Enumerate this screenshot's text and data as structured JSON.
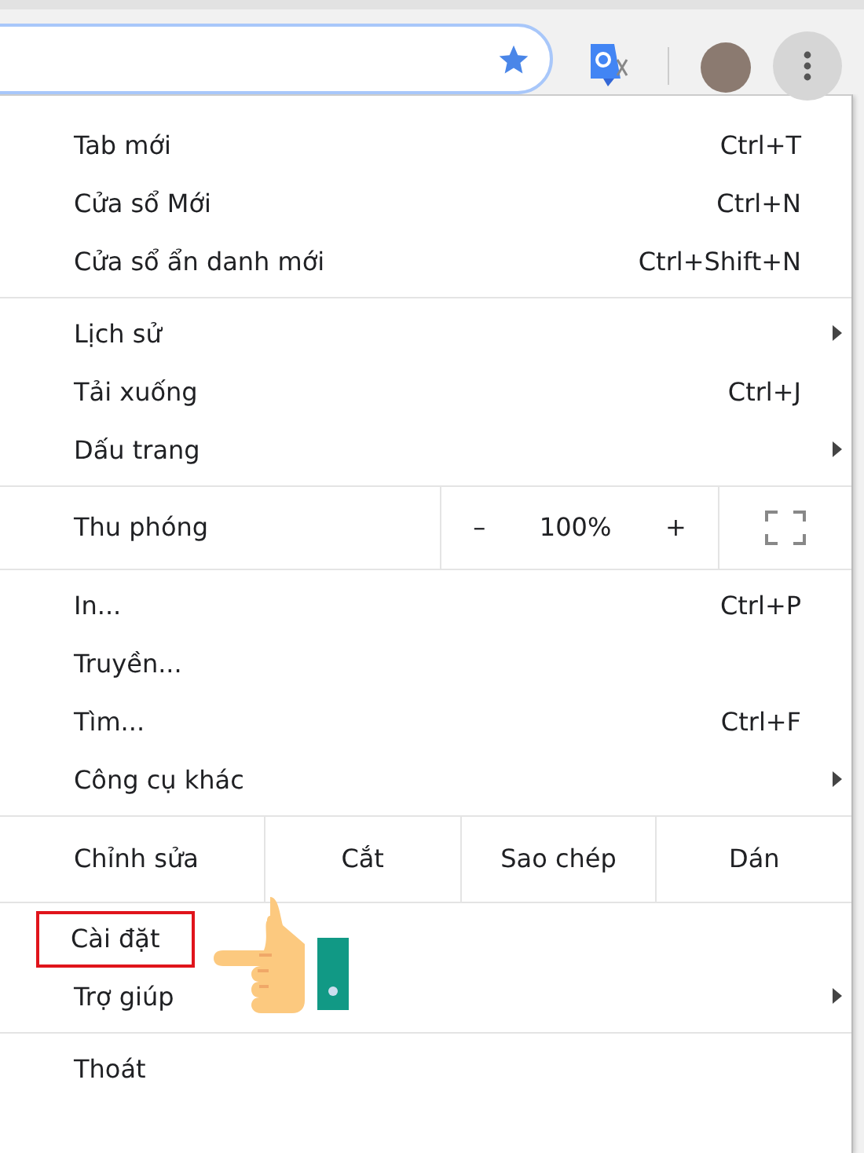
{
  "toolbar": {
    "bookmarked": true,
    "menu_open": true
  },
  "menu": {
    "groups": [
      {
        "kind": "items",
        "items": [
          {
            "label": "Tab mới",
            "shortcut": "Ctrl+T",
            "submenu": false,
            "highlighted": false
          },
          {
            "label": "Cửa sổ Mới",
            "shortcut": "Ctrl+N",
            "submenu": false,
            "highlighted": false
          },
          {
            "label": "Cửa sổ ẩn danh mới",
            "shortcut": "Ctrl+Shift+N",
            "submenu": false,
            "highlighted": false
          }
        ]
      },
      {
        "kind": "items",
        "items": [
          {
            "label": "Lịch sử",
            "submenu": true,
            "highlighted": false
          },
          {
            "label": "Tải xuống",
            "shortcut": "Ctrl+J",
            "submenu": false,
            "highlighted": false
          },
          {
            "label": "Dấu trang",
            "submenu": true,
            "highlighted": false
          }
        ]
      },
      {
        "kind": "zoom",
        "label": "Thu phóng",
        "minus": "–",
        "value": "100%",
        "plus": "+"
      },
      {
        "kind": "items",
        "items": [
          {
            "label": "In...",
            "shortcut": "Ctrl+P",
            "submenu": false,
            "highlighted": false
          },
          {
            "label": "Truyền...",
            "submenu": false,
            "highlighted": false
          },
          {
            "label": "Tìm...",
            "shortcut": "Ctrl+F",
            "submenu": false,
            "highlighted": false
          },
          {
            "label": "Công cụ khác",
            "submenu": true,
            "highlighted": false
          }
        ]
      },
      {
        "kind": "edit",
        "label": "Chỉnh sửa",
        "buttons": [
          "Cắt",
          "Sao chép",
          "Dán"
        ]
      },
      {
        "kind": "items",
        "pointer": true,
        "items": [
          {
            "label": "Cài đặt",
            "submenu": false,
            "highlighted": true
          },
          {
            "label": "Trợ giúp",
            "submenu": true,
            "highlighted": false
          }
        ]
      },
      {
        "kind": "items",
        "items": [
          {
            "label": "Thoát",
            "submenu": false,
            "highlighted": false
          }
        ]
      }
    ]
  }
}
